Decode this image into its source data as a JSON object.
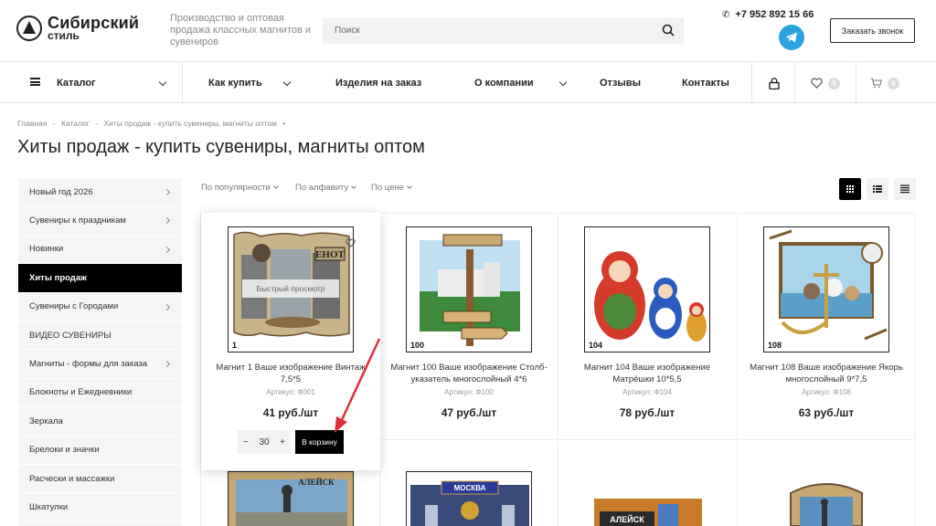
{
  "header": {
    "logo_line1": "Сибирский",
    "logo_line2": "стиль",
    "tagline": "Производство и оптовая продажа классных магнитов и сувениров",
    "search_placeholder": "Поиск",
    "phone": "+7 952 892 15 66",
    "callback_label": "Заказать звонок"
  },
  "nav": {
    "catalog": "Каталог",
    "how_to_buy": "Как купить",
    "custom": "Изделия на заказ",
    "about": "О компании",
    "reviews": "Отзывы",
    "contacts": "Контакты",
    "wishlist_count": "0",
    "cart_count": "0"
  },
  "breadcrumb": [
    "Главная",
    "-",
    "Каталог",
    "-",
    "Хиты продаж - купить сувениры, магниты оптом",
    "•"
  ],
  "page_title": "Хиты продаж - купить сувениры, магниты оптом",
  "sidebar": {
    "items": [
      {
        "label": "Новый год 2026",
        "arrow": true
      },
      {
        "label": "Сувениры к праздникам",
        "arrow": true
      },
      {
        "label": "Новинки",
        "arrow": true
      },
      {
        "label": "Хиты продаж",
        "arrow": false,
        "active": true
      },
      {
        "label": "Сувениры с Городами",
        "arrow": true
      },
      {
        "label": "ВИДЕО СУВЕНИРЫ",
        "arrow": false
      },
      {
        "label": "Магниты - формы для заказа",
        "arrow": true
      },
      {
        "label": "Блокноты и Ежедневники",
        "arrow": false
      },
      {
        "label": "Зеркала",
        "arrow": false
      },
      {
        "label": "Брелоки и значки",
        "arrow": false
      },
      {
        "label": "Расчески и массажки",
        "arrow": false
      },
      {
        "label": "Шкатулки",
        "arrow": false
      }
    ]
  },
  "sort": {
    "popularity": "По популярности",
    "alphabet": "По алфавиту",
    "price": "По цене"
  },
  "products": [
    {
      "num": "1",
      "name": "Магнит 1 Ваше изображение Винтаж 7,5*5",
      "sku": "Артикул: Ф001",
      "price": "41 руб./шт",
      "quick_view": "Быстрый просмотр",
      "qty": "30",
      "cart_label": "В корзину",
      "img_text": "ЕНОТ"
    },
    {
      "num": "100",
      "name": "Магнит 100 Ваше изображение Столб-указатель многослойный 4*6",
      "sku": "Артикул: Ф100",
      "price": "47 руб./шт"
    },
    {
      "num": "104",
      "name": "Магнит 104 Ваше изображение Матрёшки 10*5,5",
      "sku": "Артикул: Ф104",
      "price": "78 руб./шт"
    },
    {
      "num": "108",
      "name": "Магнит 108 Ваше изображение Якорь многослойный 9*7,5",
      "sku": "Артикул: Ф108",
      "price": "63 руб./шт"
    }
  ],
  "row2_labels": [
    "АЛЕЙСК",
    "МОСКВА",
    "АЛЕЙСК"
  ],
  "colors": {
    "accent": "#000000",
    "telegram": "#2aa3e0",
    "arrow": "#e0303a"
  }
}
